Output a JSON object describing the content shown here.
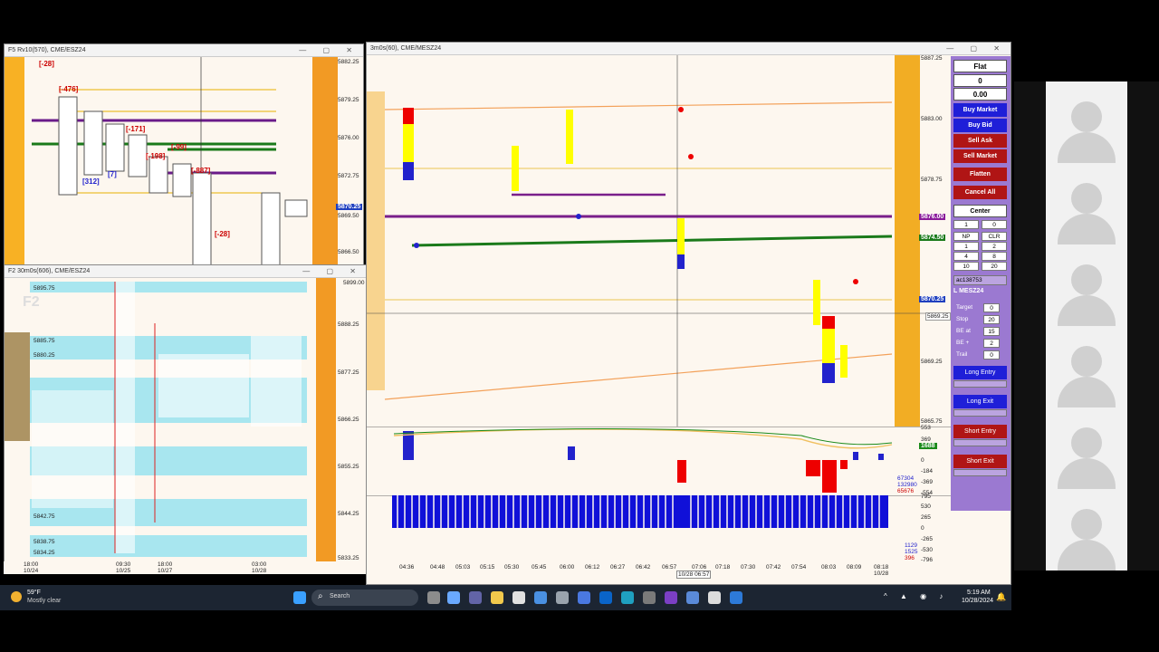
{
  "win_top_left": {
    "title": "F5 Rv10(570), CME/ESZ24",
    "prices": [
      "5882.25",
      "5879.25",
      "5876.00",
      "5872.75",
      "5869.50",
      "5866.50"
    ],
    "current": "5870.25",
    "labels": [
      "[-28]",
      "[-476]",
      "[-171]",
      "[-198]",
      "[-99]",
      "[-887]",
      "[312]",
      "[7]",
      "[-28]"
    ]
  },
  "win_bottom_left": {
    "title": "F2 30m0s(606), CME/ESZ24",
    "watermark": "F2",
    "prices": [
      "5899.00",
      "5888.25",
      "5877.25",
      "5866.25",
      "5855.25",
      "5844.25",
      "5833.25"
    ],
    "levels": [
      "5895.75",
      "5885.75",
      "5880.25",
      "5842.75",
      "5838.75",
      "5834.25"
    ],
    "times": [
      {
        "t": "18:00",
        "d": "10/24"
      },
      {
        "t": "09:30",
        "d": "10/25"
      },
      {
        "t": "18:00",
        "d": "10/27"
      },
      {
        "t": "03:00",
        "d": "10/28"
      }
    ]
  },
  "win_main": {
    "title": "3m0s(60), CME/MESZ24",
    "prices": [
      "5887.25",
      "5883.00",
      "5878.75",
      "5874.50",
      "5869.25",
      "5865.75",
      "5861.50"
    ],
    "tags": {
      "p1": "5876.00",
      "p2": "5874.50",
      "p3": "5870.25",
      "p4": "5869.25"
    },
    "times": [
      "04:36",
      "04:48",
      "05:03",
      "05:15",
      "05:30",
      "05:45",
      "06:00",
      "06:12",
      "06:27",
      "06:42",
      "06:57",
      "07:06",
      "07:18",
      "07:30",
      "07:42",
      "07:54",
      "08:03",
      "08:09",
      "08:18"
    ],
    "date_label": "10/28",
    "cursor_time": "10/28 06:57",
    "ind1_scale": [
      "553",
      "369",
      "184",
      "0",
      "-184",
      "-369",
      "-554"
    ],
    "ind1_vals": [
      "1688",
      "67304",
      "132980",
      "65676"
    ],
    "ind2_scale": [
      "795",
      "530",
      "265",
      "0",
      "-265",
      "-530",
      "-796"
    ],
    "ind2_vals": [
      "1129",
      "1525",
      "396"
    ]
  },
  "side_panel": {
    "status": "Flat",
    "pos": "0",
    "pnl": "0.00",
    "buy_market": "Buy Market",
    "buy_bid": "Buy Bid",
    "sell_ask": "Sell Ask",
    "sell_market": "Sell Market",
    "flatten": "Flatten",
    "cancel_all": "Cancel All",
    "center": "Center",
    "qty": "1",
    "qty2": "0",
    "np": "NP",
    "clr": "CLR",
    "grid": [
      "1",
      "2",
      "4",
      "8",
      "10",
      "20"
    ],
    "account": "ac138753",
    "instrument": "L MESZ24",
    "target_lbl": "Target",
    "target": "0",
    "stop_lbl": "Stop",
    "stop": "20",
    "beat_lbl": "BE at",
    "beat": "15",
    "beplus_lbl": "BE +",
    "beplus": "2",
    "trail_lbl": "Trail",
    "trail": "0",
    "long_entry": "Long Entry",
    "long_exit": "Long Exit",
    "short_entry": "Short Entry",
    "short_exit": "Short Exit"
  },
  "taskbar": {
    "temp": "59°F",
    "weather": "Mostly clear",
    "search": "Search",
    "time": "5:19 AM",
    "date": "10/28/2024"
  },
  "colors": {
    "buy": "#1f1fd8",
    "sell": "#b01515",
    "panel": "#9b79d1",
    "cyan_band": "#a8e6ef"
  }
}
